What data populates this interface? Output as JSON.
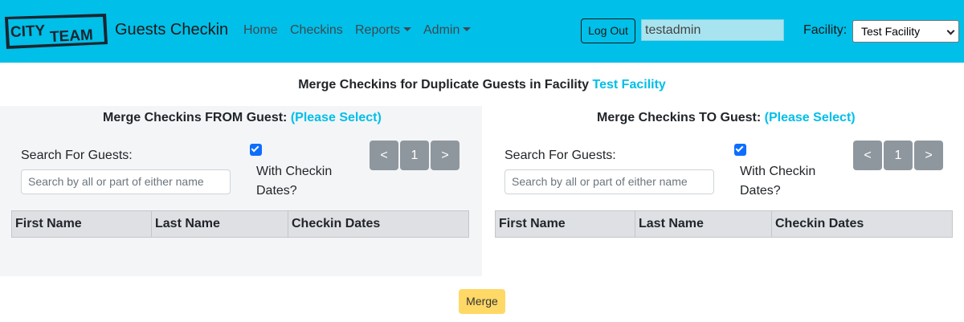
{
  "navbar": {
    "logo_line1": "CITY",
    "logo_line2": "TEAM",
    "brand": "Guests Checkin",
    "links": [
      {
        "label": "Home"
      },
      {
        "label": "Checkins"
      },
      {
        "label": "Reports"
      },
      {
        "label": "Admin"
      }
    ],
    "logout_label": "Log Out",
    "username": "testadmin",
    "facility_label": "Facility:",
    "facility_selected": "Test Facility",
    "colors": {
      "navbar_bg": "#00bfe8"
    }
  },
  "page": {
    "title_prefix": "Merge Checkins for Duplicate Guests in Facility ",
    "facility_name": "Test Facility"
  },
  "from_panel": {
    "heading": "Merge Checkins FROM Guest: ",
    "selection": "(Please Select)",
    "search_label": "Search For Guests:",
    "search_placeholder": "Search by all or part of either name",
    "checkbox_label": "With Checkin Dates?",
    "checkbox_checked": true,
    "prev_label": "<",
    "page_number": "1",
    "next_label": ">",
    "columns": [
      "First Name",
      "Last Name",
      "Checkin Dates"
    ]
  },
  "to_panel": {
    "heading": "Merge Checkins TO Guest: ",
    "selection": "(Please Select)",
    "search_label": "Search For Guests:",
    "search_placeholder": "Search by all or part of either name",
    "checkbox_label": "With Checkin Dates?",
    "checkbox_checked": true,
    "prev_label": "<",
    "page_number": "1",
    "next_label": ">",
    "columns": [
      "First Name",
      "Last Name",
      "Checkin Dates"
    ]
  },
  "merge_label": "Merge"
}
